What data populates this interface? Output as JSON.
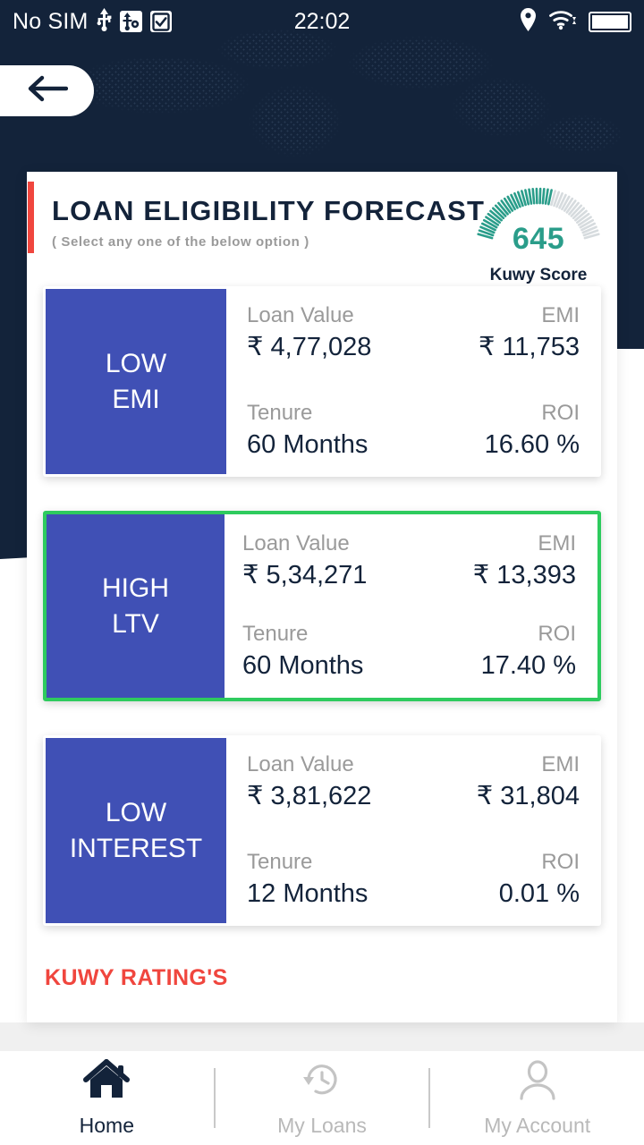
{
  "status_bar": {
    "carrier": "No SIM",
    "time": "22:02",
    "left_icons": [
      "usb-icon",
      "usb-settings-icon",
      "checkbox-icon"
    ],
    "right_icons": [
      "location-pin-icon",
      "wifi-icon",
      "battery-full-icon"
    ]
  },
  "nav": {
    "back_icon": "arrow-left-icon"
  },
  "header": {
    "title": "LOAN ELIGIBILITY FORECAST",
    "subtitle": "( Select any one of the below option )",
    "accent_color": "#F0463E"
  },
  "score_gauge": {
    "value": "645",
    "label": "Kuwy Score",
    "filled_color": "#2A9D8A",
    "empty_color": "#D6DBDE",
    "total_ticks": 44,
    "filled_ticks": 26
  },
  "labels": {
    "loan_value": "Loan Value",
    "emi": "EMI",
    "tenure": "Tenure",
    "roi": "ROI"
  },
  "options": [
    {
      "name": "LOW\nEMI",
      "name_line1": "LOW",
      "name_line2": "EMI",
      "loan_value": "₹ 4,77,028",
      "emi": "₹ 11,753",
      "tenure": "60 Months",
      "roi": "16.60 %",
      "selected": false
    },
    {
      "name": "HIGH\nLTV",
      "name_line1": "HIGH",
      "name_line2": "LTV",
      "loan_value": "₹ 5,34,271",
      "emi": "₹ 13,393",
      "tenure": "60 Months",
      "roi": "17.40 %",
      "selected": true
    },
    {
      "name": "LOW\nINTEREST",
      "name_line1": "LOW",
      "name_line2": "INTEREST",
      "loan_value": "₹ 3,81,622",
      "emi": "₹ 31,804",
      "tenure": "12 Months",
      "roi": "0.01 %",
      "selected": false
    }
  ],
  "ratings_heading": "KUWY RATING'S",
  "bottom_nav": {
    "items": [
      {
        "label": "Home",
        "icon": "home-icon",
        "active": true
      },
      {
        "label": "My Loans",
        "icon": "history-clock-icon",
        "active": false
      },
      {
        "label": "My Account",
        "icon": "person-icon",
        "active": false
      }
    ]
  },
  "colors": {
    "navy": "#13233A",
    "tile_blue": "#4050B5",
    "selected_green": "#2ECB5E",
    "red": "#F0463E",
    "teal": "#2A9D8A",
    "muted_grey": "#9A9A9A"
  }
}
